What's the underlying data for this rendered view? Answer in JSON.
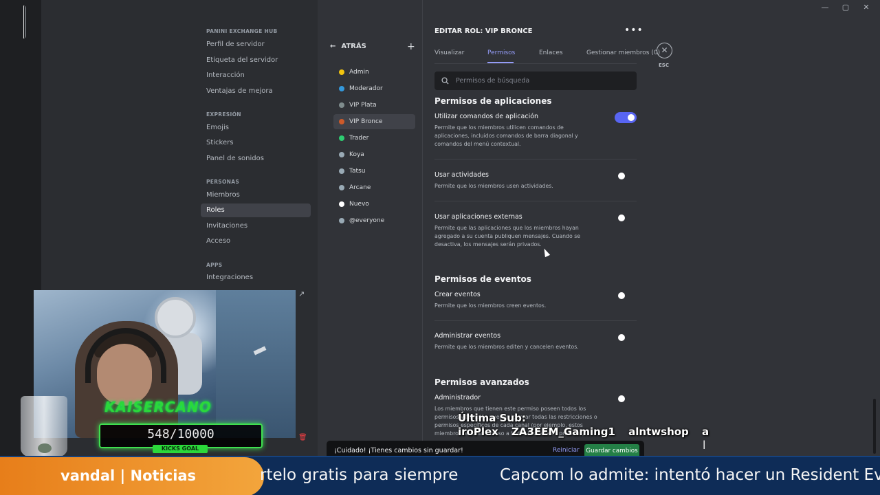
{
  "window": {
    "minimize": "—",
    "maximize": "▢",
    "close": "✕"
  },
  "sidebar": {
    "server_name": "PANINI EXCHANGE HUB",
    "items_top": [
      "Perfil de servidor",
      "Etiqueta del servidor",
      "Interacción",
      "Ventajas de mejora"
    ],
    "expression_label": "EXPRESIÓN",
    "items_expression": [
      "Emojis",
      "Stickers",
      "Panel de sonidos"
    ],
    "people_label": "PERSONAS",
    "items_people": [
      "Miembros",
      "Roles",
      "Invitaciones",
      "Acceso"
    ],
    "apps_label": "APPS",
    "items_apps": [
      "Integraciones"
    ]
  },
  "roles_panel": {
    "back_label": "ATRÁS",
    "add_label": "+",
    "roles": [
      {
        "name": "Admin",
        "color": "#f1c40f"
      },
      {
        "name": "Moderador",
        "color": "#3498db"
      },
      {
        "name": "VIP Plata",
        "color": "#7f8c8d"
      },
      {
        "name": "VIP Bronce",
        "color": "#cd5a2a"
      },
      {
        "name": "Trader",
        "color": "#2ecc71"
      },
      {
        "name": "Koya",
        "color": "#99aab5"
      },
      {
        "name": "Tatsu",
        "color": "#99aab5"
      },
      {
        "name": "Arcane",
        "color": "#99aab5"
      },
      {
        "name": "Nuevo",
        "color": "#ffffff"
      },
      {
        "name": "@everyone",
        "color": "#99aab5"
      }
    ],
    "active_role": "VIP Bronce"
  },
  "editor": {
    "title": "EDITAR ROL: VIP BRONCE",
    "more": "•••",
    "tabs": [
      "Visualizar",
      "Permisos",
      "Enlaces",
      "Gestionar miembros (0)"
    ],
    "active_tab": "Permisos",
    "close_glyph": "✕",
    "esc_label": "ESC",
    "search_placeholder": "Permisos de búsqueda",
    "groups": {
      "apps": "Permisos de aplicaciones",
      "events": "Permisos de eventos",
      "advanced": "Permisos avanzados"
    },
    "permissions": {
      "use_app_commands": {
        "title": "Utilizar comandos de aplicación",
        "desc": "Permite que los miembros utilicen comandos de aplicaciones, incluidos comandos de barra diagonal y comandos del menú contextual.",
        "enabled": true
      },
      "use_activities": {
        "title": "Usar actividades",
        "desc": "Permite que los miembros usen actividades.",
        "enabled": false
      },
      "use_external_apps": {
        "title": "Usar aplicaciones externas",
        "desc": "Permite que las aplicaciones que los miembros hayan agregado a su cuenta publiquen mensajes. Cuando se desactiva, los mensajes serán privados.",
        "enabled": false
      },
      "create_events": {
        "title": "Crear eventos",
        "desc": "Permite que los miembros creen eventos.",
        "enabled": false
      },
      "manage_events": {
        "title": "Administrar eventos",
        "desc": "Permite que los miembros editen y cancelen eventos.",
        "enabled": false
      },
      "administrator": {
        "title": "Administrador",
        "desc": "Los miembros que tienen este permiso poseen todos los permisos y también pueden ignorar todas las restricciones o permisos específicos de cada canal (por ejemplo, estos miembros tendrán acceso a todos los canales privados).",
        "enabled": false
      }
    }
  },
  "savebar": {
    "message": "¡Cuidado! ¡Tienes cambios sin guardar!",
    "reset_label": "Reiniciar",
    "save_label": "Guardar cambios"
  },
  "stream_overlay": {
    "streamer": "KAISERCANO",
    "kicks_count": "548/10000",
    "kicks_goal_label": "KICKS GOAL",
    "last_sub_label": "Última Sub:",
    "last_sub_names": "iroPlex   ZA3EEM_Gaming1   alntwshop   a",
    "ticker_brand": "vandal | Noticias",
    "ticker_item_1": "rtelo gratis para siempre",
    "ticker_item_2": "Capcom lo admite: intentó hacer un Resident Evi"
  },
  "colors": {
    "accent": "#5865f2",
    "save": "#248046",
    "brand_green": "#2bd83a",
    "ticker_orange": "#e77e1a"
  }
}
